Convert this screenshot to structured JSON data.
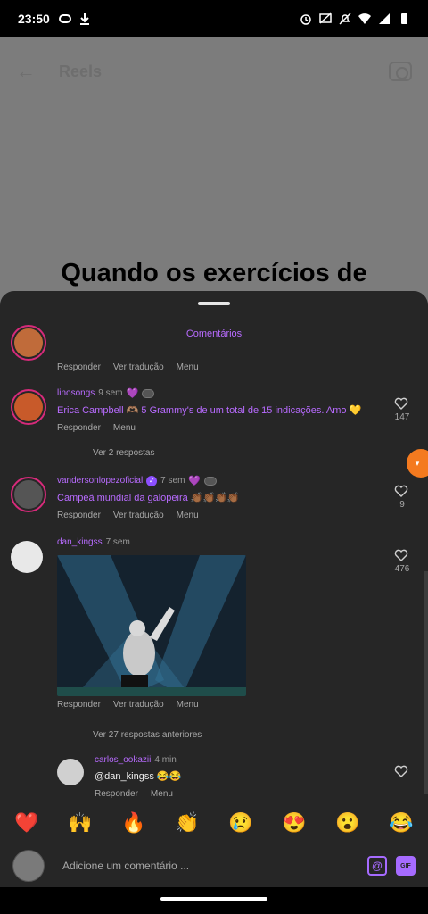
{
  "status": {
    "time": "23:50",
    "left_icons": [
      "msg-icon",
      "download-icon"
    ],
    "right_icons": [
      "alarm-icon",
      "cast-off-icon",
      "mute-icon",
      "wifi-icon",
      "signal-icon",
      "battery-icon"
    ]
  },
  "reels": {
    "title": "Reels",
    "caption": "Quando os exercícios de"
  },
  "sheet": {
    "title": "Comentários",
    "top_cut_actions": [
      "Responder",
      "Ver tradução",
      "Menu"
    ]
  },
  "comments": [
    {
      "username": "linosongs",
      "ago": "9 sem",
      "text": "Erica Campbell 🫶🏽 5 Grammy's de um total de 15 indicações. Amo 💛",
      "actions": [
        "Responder",
        "Menu"
      ],
      "likes": "147",
      "view_replies": "Ver 2 respostas"
    },
    {
      "username": "vandersonlopezoficial",
      "ago": "7 sem",
      "text": "Campeã mundial da galopeira 👏🏾👏🏾👏🏾👏🏾",
      "actions": [
        "Responder",
        "Ver tradução",
        "Menu"
      ],
      "likes": "9"
    },
    {
      "username": "dan_kingss",
      "ago": "7 sem",
      "actions": [
        "Responder",
        "Ver tradução",
        "Menu"
      ],
      "likes": "476",
      "view_replies": "Ver 27 respostas anteriores"
    }
  ],
  "reply": {
    "username": "carlos_ookazii",
    "ago": "4 min",
    "text": "@dan_kingss 😂😂",
    "actions": [
      "Responder",
      "Menu"
    ]
  },
  "emoji_bar": [
    "❤️",
    "🙌",
    "🔥",
    "👏",
    "😢",
    "😍",
    "😮",
    "😂"
  ],
  "composer": {
    "placeholder": "Adicione um comentário ...",
    "mention_label": "@",
    "gif_label": "GIF"
  },
  "colors": {
    "accent": "#8c4fff",
    "sheet_bg": "#262626",
    "bubble": "#f47a1f"
  }
}
